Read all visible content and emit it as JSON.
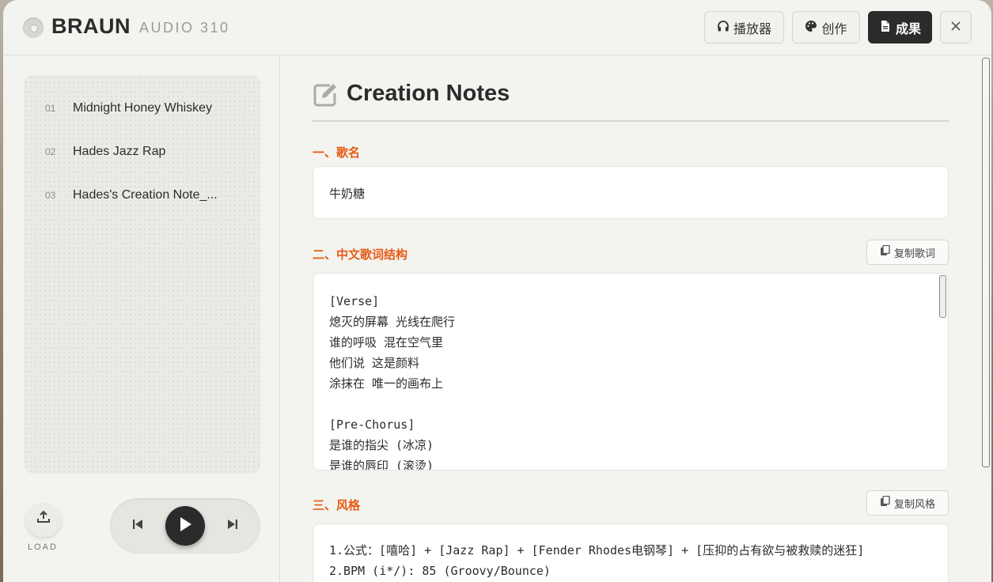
{
  "header": {
    "brand": "BRAUN",
    "model": "AUDIO 310",
    "tabs": [
      {
        "label": "播放器",
        "icon": "headphones-icon"
      },
      {
        "label": "创作",
        "icon": "palette-icon"
      },
      {
        "label": "成果",
        "icon": "document-icon",
        "active": true
      }
    ],
    "close_icon": "close-icon"
  },
  "sidebar": {
    "tracks": [
      {
        "num": "01",
        "title": "Midnight Honey Whiskey"
      },
      {
        "num": "02",
        "title": "Hades Jazz Rap"
      },
      {
        "num": "03",
        "title": "Hades's Creation Note_..."
      }
    ],
    "load_label": "LOAD"
  },
  "main": {
    "title": "Creation Notes",
    "sections": {
      "song_name": {
        "label": "一、歌名",
        "value": "牛奶糖"
      },
      "lyrics": {
        "label": "二、中文歌词结构",
        "copy_label": "复制歌词",
        "text": "[Verse]\n熄灭的屏幕 光线在爬行\n谁的呼吸 混在空气里\n他们说 这是颜料\n涂抹在 唯一的画布上\n\n[Pre-Chorus]\n是谁的指尖 (冰凉)\n是谁的唇印 (滚烫)"
      },
      "style": {
        "label": "三、风格",
        "copy_label": "复制风格",
        "text": "1.公式：[嘻哈] + [Jazz Rap] + [Fender Rhodes电钢琴] + [压抑的占有欲与被救赎的迷狂]\n2.BPM (i*/): 85 (Groovy/Bounce)"
      }
    }
  },
  "colors": {
    "accent": "#e85a14",
    "dark": "#2b2b2b",
    "panel": "#f3f3ef"
  }
}
